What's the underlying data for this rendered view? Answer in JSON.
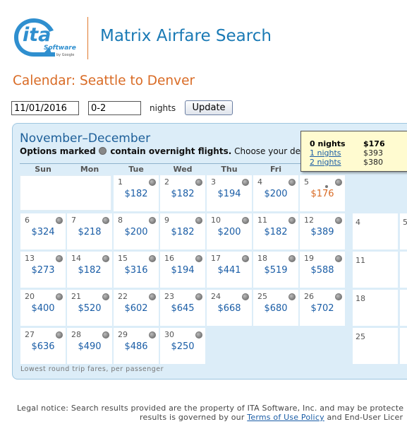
{
  "header": {
    "logo_text": "ita",
    "logo_sub": "Software",
    "logo_by": "by Google",
    "app_title": "Matrix Airfare Search"
  },
  "page_title": "Calendar: Seattle to Denver",
  "form": {
    "date_value": "11/01/2016",
    "nights_value": "0-2",
    "nights_label": "nights",
    "update_label": "Update"
  },
  "calendar": {
    "month_title": "November–December",
    "subtitle_bold_1": "Options marked",
    "subtitle_bold_2": "contain overnight flights.",
    "subtitle_rest": "Choose your dep",
    "days_of_week": [
      "Sun",
      "Mon",
      "Tue",
      "Wed",
      "Thu",
      "Fri"
    ],
    "cells": [
      {
        "day": "1",
        "price": "$182"
      },
      {
        "day": "2",
        "price": "$182"
      },
      {
        "day": "3",
        "price": "$194"
      },
      {
        "day": "4",
        "price": "$200"
      },
      {
        "day": "5",
        "price": "$176"
      },
      {
        "day": "6",
        "price": "$324"
      },
      {
        "day": "7",
        "price": "$218"
      },
      {
        "day": "8",
        "price": "$200"
      },
      {
        "day": "9",
        "price": "$182"
      },
      {
        "day": "10",
        "price": "$200"
      },
      {
        "day": "11",
        "price": "$182"
      },
      {
        "day": "12",
        "price": "$389"
      },
      {
        "day": "13",
        "price": "$273"
      },
      {
        "day": "14",
        "price": "$182"
      },
      {
        "day": "15",
        "price": "$316"
      },
      {
        "day": "16",
        "price": "$194"
      },
      {
        "day": "17",
        "price": "$441"
      },
      {
        "day": "18",
        "price": "$519"
      },
      {
        "day": "19",
        "price": "$588"
      },
      {
        "day": "20",
        "price": "$400"
      },
      {
        "day": "21",
        "price": "$520"
      },
      {
        "day": "22",
        "price": "$602"
      },
      {
        "day": "23",
        "price": "$645"
      },
      {
        "day": "24",
        "price": "$668"
      },
      {
        "day": "25",
        "price": "$680"
      },
      {
        "day": "26",
        "price": "$702"
      },
      {
        "day": "27",
        "price": "$636"
      },
      {
        "day": "28",
        "price": "$490"
      },
      {
        "day": "29",
        "price": "$486"
      },
      {
        "day": "30",
        "price": "$250"
      }
    ],
    "right_column": [
      "4",
      "11",
      "18",
      "25"
    ],
    "right_column_2": [
      "5"
    ],
    "footnote": "Lowest round trip fares, per passenger"
  },
  "tooltip": {
    "rows": [
      {
        "label": "0 nights",
        "price": "$176"
      },
      {
        "label": "1 nights",
        "price": "$393"
      },
      {
        "label": "2 nights",
        "price": "$380"
      }
    ]
  },
  "legal": {
    "line1": "Legal notice: Search results provided are the property of ITA Software, Inc. and may be protecte",
    "line2_pre": "results is governed by our",
    "terms_link": "Terms of Use Policy",
    "line2_post": "and End-User Licer"
  },
  "colors": {
    "accent_blue": "#1a7ab5",
    "accent_orange": "#d96b25",
    "panel_bg": "#dcedf8",
    "tooltip_bg": "#fffbd0"
  }
}
